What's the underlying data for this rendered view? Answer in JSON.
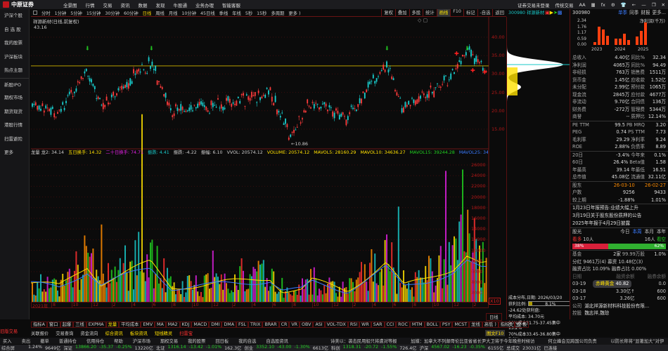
{
  "topbar": {
    "logo": "中原证券",
    "menu": [
      "全景图",
      "行情",
      "交易",
      "资讯",
      "数据",
      "发现",
      "牛股通",
      "业务办理",
      "智能客服"
    ],
    "login": "证券交易未登录",
    "classic": "传统交易"
  },
  "sidebar": [
    "沪深个股",
    "自 选 股",
    "我的股票",
    "沪深板块",
    "热点主题",
    "新股IPO",
    "期权市场",
    "期货现货",
    "港股行情",
    "扫雷避险",
    "更多"
  ],
  "periods": [
    "分时",
    "1分钟",
    "5分钟",
    "15分钟",
    "30分钟",
    "60分钟",
    "日线",
    "周线",
    "月线",
    "10分钟",
    "45日线",
    "季线",
    "年线",
    "5秒",
    "15秒",
    "多周期",
    "更多 )"
  ],
  "tools": [
    "复权",
    "叠加",
    "多股",
    "统计",
    "画线",
    "F10",
    "标记",
    "-自选",
    "返回"
  ],
  "chart": {
    "title": "祥源新材(日线,前复权)",
    "max_label": "43.16",
    "min_label": "10.86",
    "price_ticks": [
      "40.00",
      "35.00",
      "30.00",
      "25.00",
      "20.00",
      "15.00"
    ],
    "vol_ticks": [
      "26000",
      "24000",
      "22000",
      "20000",
      "18000",
      "16000",
      "14000",
      "12000",
      "10000",
      "8000",
      "6000",
      "4000",
      "2000"
    ],
    "year_label": "2021年",
    "x_ticks": [
      "8",
      "10",
      "12",
      "2",
      "4",
      "6",
      "8",
      "10",
      "12",
      "2",
      "4",
      "6",
      "8",
      "10",
      "12",
      "2",
      "4",
      "6",
      "8",
      "10",
      "12",
      "2"
    ],
    "x10": "X10"
  },
  "indicators": [
    {
      "t": "龙量 龙2: 34.14",
      "c": "#ccc"
    },
    {
      "t": "五日换手: 14.32",
      "c": "#ffe000"
    },
    {
      "t": "二十日换手: 74.71",
      "c": "#e020e0"
    },
    {
      "t": "振跌: 4.41",
      "c": "#19c8c8"
    },
    {
      "t": "振跌: -4.22",
      "c": "#ccc"
    },
    {
      "t": "振幅: 6.10",
      "c": "#ccc"
    },
    {
      "t": "VVOL: 20574.12",
      "c": "#ccc"
    },
    {
      "t": "VOLUME: 20574.12",
      "c": "#ffe000"
    },
    {
      "t": "MAVOL5: 28160.29",
      "c": "#ffe000"
    },
    {
      "t": "MAVOL10: 34636.27",
      "c": "#ffe000"
    },
    {
      "t": "MAVOL15: 39244.28",
      "c": "#20d020"
    },
    {
      "t": "MAVOL25: 34847.40",
      "c": "#3a7bff"
    }
  ],
  "stock": {
    "header": "300980 祥源新材",
    "code": "300980"
  },
  "chip": {
    "title": "成本分布,日期: 2026/03/20",
    "profit_label": "获利比例:",
    "profit": "8.1%",
    "profit_pct": 8.1,
    "lines": [
      "-24.62处获利盘:",
      "平均成本: 34.70元",
      "90%成本31.75-37.45集中13.2%",
      "70%成本33.45-36.80集中7.8%"
    ],
    "period": "日线"
  },
  "panel": {
    "tabs": [
      "单季",
      "同季",
      "财报",
      "更多..."
    ],
    "chart_title": "净利润(千万)",
    "y_ticks": [
      "2.34",
      "1.76",
      "1.17",
      "0.59",
      "0.00"
    ],
    "years": [
      "2023",
      "2024",
      "2025"
    ],
    "bars": [
      0.3,
      1.8,
      1.5,
      0.9,
      0.6,
      0.6,
      1.1,
      0.5,
      0.8,
      1.4,
      2.2
    ],
    "fin": [
      [
        "总收入",
        "4.40亿",
        "同比%",
        "32.34"
      ],
      [
        "净利润",
        "4065万",
        "同比%",
        "94.49"
      ],
      [
        "非经损",
        "763万",
        "销售费",
        "1511万"
      ],
      [
        "货币金",
        "1.45亿",
        "应收款",
        "1.52亿"
      ],
      [
        "未分配",
        "2.99亿",
        "预付款",
        "1065万"
      ],
      [
        "现金流",
        "2845万",
        "应付款",
        "4677万"
      ],
      [
        "非流动",
        "9.70亿",
        "合同债",
        "136万"
      ],
      [
        "财务费",
        "-272万",
        "管理费",
        "5344万"
      ],
      [
        "商誉",
        "--",
        "质押比",
        "12.14%"
      ]
    ],
    "val": [
      [
        "PE TTM",
        "99.5",
        "PB MRQ",
        "3.20"
      ],
      [
        "PEG",
        "0.74",
        "PS TTM",
        "7.73"
      ],
      [
        "毛利率",
        "29.29",
        "净利率",
        "9.24"
      ],
      [
        "ROE",
        "2.88%",
        "负债率",
        "8.89"
      ]
    ],
    "perf": [
      [
        "20日",
        "-3.4%",
        "今年来",
        "0.1%"
      ],
      [
        "60日",
        "26.4%",
        "Beta值",
        "1.58"
      ],
      [
        "年最高",
        "39.14",
        "年最低",
        "16.51"
      ],
      [
        "总市值",
        "45.08亿",
        "流通值",
        "32.11亿"
      ]
    ],
    "holders": [
      [
        "股东",
        "26-03-10",
        "26-02-27"
      ],
      [
        "户数",
        "9256",
        "9433"
      ],
      [
        "较上期",
        "-1.88%",
        "1.01%"
      ]
    ],
    "news": [
      "1月23日年报预告:业绩大幅上升",
      "3月19日关于股东股份质押的公告",
      "2025年年报于4月29日披露"
    ],
    "vote": {
      "label": "股光",
      "tabs": [
        "今日",
        "本周",
        "本月",
        "本年"
      ],
      "bull": "看多",
      "bull_n": "10人",
      "bear_n": "16人",
      "bear": "看空",
      "bull_pct": "38%",
      "bear_pct": "62%",
      "bull_frac": 38
    },
    "fund": [
      [
        "基金",
        "2家",
        "99.99万股",
        "1.0%"
      ]
    ],
    "div": "分红 9461万(4) 募资 10.48亿(3)",
    "margin": "融资占比 10.09% 融券占比 0.00%",
    "mtable": [
      [
        "日期",
        "融资余额",
        "融券余额"
      ],
      [
        "03-19",
        "",
        "0.0"
      ],
      [
        "03-18",
        "3.30亿↑",
        "600"
      ],
      [
        "03-17",
        "3.26亿",
        "600"
      ]
    ],
    "popup": {
      "name": "赤峰黄金",
      "val": "40.82"
    },
    "company": [
      [
        "公司",
        "湖北祥源新材料科技股份有限..."
      ],
      [
        "控股",
        "魏志祥,魏琼"
      ]
    ]
  },
  "bottom": {
    "tabs": [
      "指标A",
      "窗口",
      "起爆",
      "三线",
      "EXPMA",
      "龙量",
      "平均成本",
      "EMV",
      "MA",
      "MA2",
      "KDJ",
      "MACD",
      "DMI",
      "DMA",
      "FSL",
      "TRIX",
      "BRAR",
      "CR",
      "VR",
      "OBV",
      "ASI",
      "VOL-TDX",
      "RSI",
      "WR",
      "SAR",
      "CCI",
      "ROC",
      "MTM",
      "BOLL",
      "PSY",
      "MCST",
      "龙线",
      "高低 )",
      "指标B",
      "模 板"
    ],
    "links": [
      "关联报价",
      "交易查询",
      "资金流向",
      "综合资讯",
      "板块资讯",
      "短线精灵",
      "扫雷宝"
    ],
    "f10": "图文F10",
    "actions": [
      "卖出",
      "撤单",
      "普通持仓",
      "信用持仓",
      "帮助",
      "沪深市场",
      "期权交易",
      "我的股票",
      "回日板",
      "我的自选",
      "自选股资讯"
    ],
    "news": [
      "诗美以：袭击民用船只将遭对等报复",
      "加媒：加拿大不列颠哥伦比亚省省长尹大卫将于今年晚些时候访华",
      "何立峰会见跨国公司负责人",
      "以防长称将“显著加大”对伊朗"
    ],
    "left": [
      "旧版交易",
      "买入",
      "综合屏"
    ],
    "status": [
      "1.24%",
      "9649亿",
      "深证",
      "13866.20",
      "-35.37",
      "-0.25%",
      "13220亿",
      "北证",
      "1316.14",
      "-13.42",
      "-1.01%",
      "162.3亿",
      "创业",
      "3352.10",
      "-43.00",
      "-1.30%",
      "6613亿",
      "科创",
      "1318.31",
      "-20.72",
      "-1.55%",
      "726.4亿",
      "沪深",
      "4567.02",
      "-16.23",
      "-0.35%",
      "6155亿",
      "总成交",
      "23031亿",
      "已连接"
    ]
  }
}
